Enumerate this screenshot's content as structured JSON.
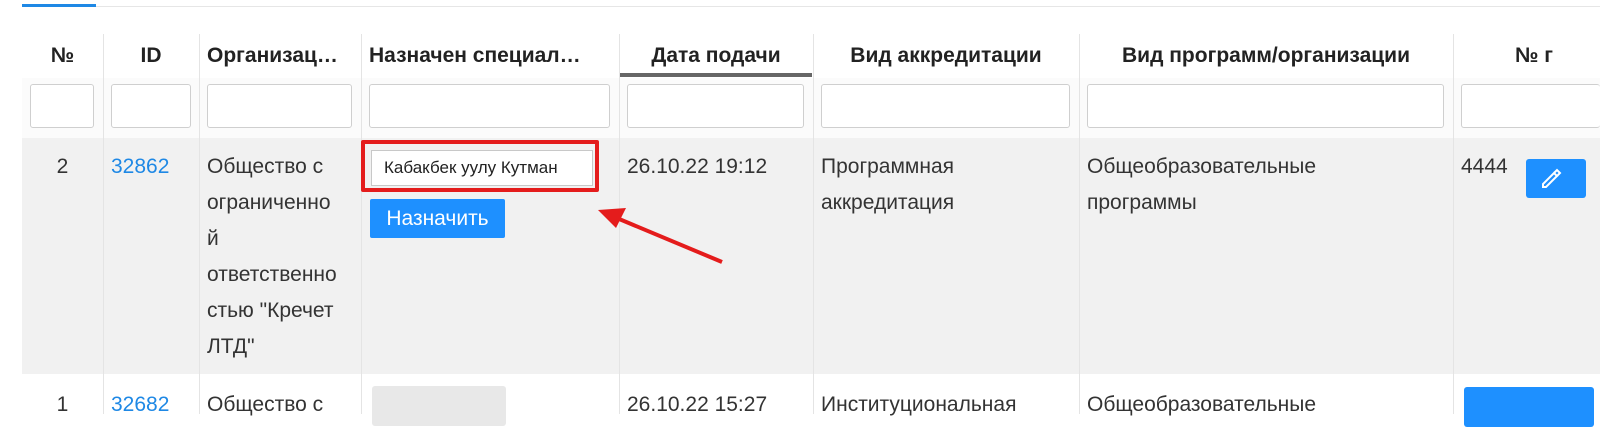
{
  "table": {
    "headers": {
      "num": "№",
      "id": "ID",
      "organization": "Организац…",
      "specialist": "Назначен специал…",
      "date": "Дата подачи",
      "accreditation_type": "Вид аккредитации",
      "program_type": "Вид программ/организации",
      "number": "№ г"
    },
    "rows": [
      {
        "num": "2",
        "id": "32862",
        "organization_lines": [
          "Общество с",
          "ограниченно",
          "й",
          "ответственно",
          "стью \"Кречет",
          "ЛТД\""
        ],
        "specialist_selected": "Кабакбек уулу Кутман",
        "assign_label": "Назначить",
        "date": "26.10.22 19:12",
        "accreditation_lines": [
          "Программная",
          "аккредитация"
        ],
        "program_lines": [
          "Общеобразовательные",
          "программы"
        ],
        "number": "4444"
      },
      {
        "num": "1",
        "id": "32682",
        "organization_partial": "Общество с",
        "date_partial": "26.10.22 15:27",
        "accreditation_partial": "Институциональная",
        "program_partial": "Общеобразовательные"
      }
    ]
  },
  "colors": {
    "accent": "#1e90ff",
    "link": "#1e88e5",
    "highlight": "#e41c1c"
  },
  "icons": {
    "edit": "pencil-icon"
  }
}
